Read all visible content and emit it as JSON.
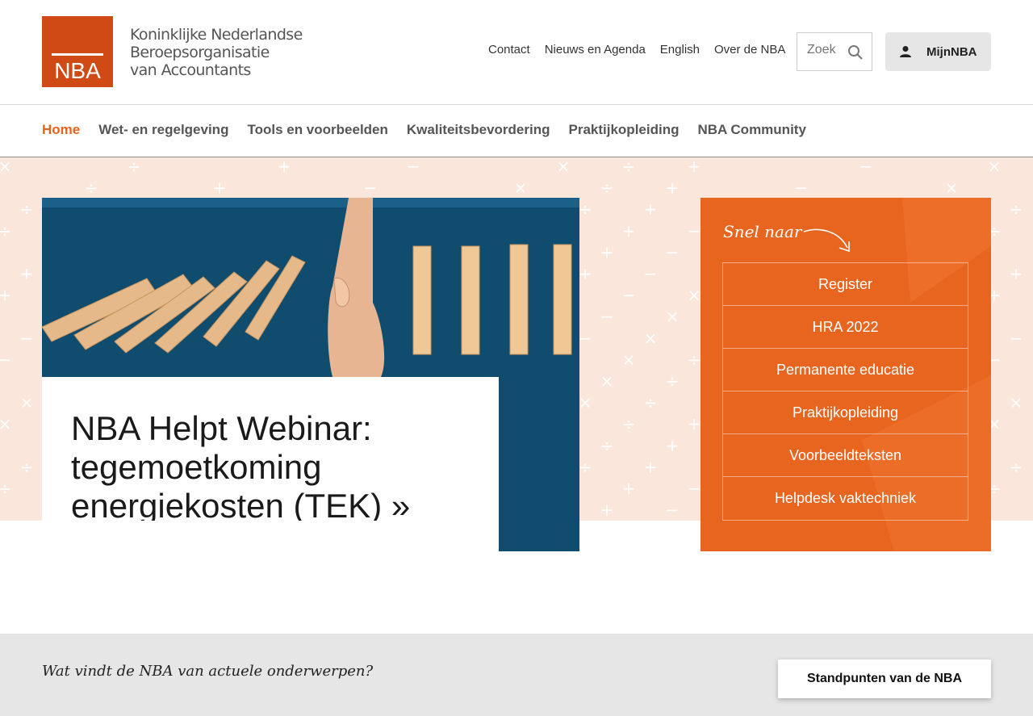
{
  "header": {
    "logo_text": "NBA",
    "org_name_lines": [
      "Koninklijke Nederlandse",
      "Beroepsorganisatie",
      "van Accountants"
    ],
    "util_nav": [
      "Contact",
      "Nieuws en Agenda",
      "English",
      "Over de NBA"
    ],
    "search_placeholder": "Zoek",
    "mijn_label": "MijnNBA"
  },
  "main_nav": {
    "items": [
      "Home",
      "Wet- en regelgeving",
      "Tools en voorbeelden",
      "Kwaliteitsbevordering",
      "Praktijkopleiding",
      "NBA Community"
    ],
    "active": "Home"
  },
  "hero": {
    "title": "NBA Helpt Webinar: tegemoetkoming energiekosten (TEK) »"
  },
  "snel_naar": {
    "title": "Snel naar",
    "items": [
      "Register",
      "HRA 2022",
      "Permanente educatie",
      "Praktijkopleiding",
      "Voorbeeldteksten",
      "Helpdesk vaktechniek"
    ]
  },
  "bottom": {
    "question": "Wat vindt de NBA van actuele onderwerpen?",
    "button_label": "Standpunten van de NBA"
  },
  "colors": {
    "brand_orange": "#e8651f",
    "logo_orange": "#cf4a14",
    "hero_bg": "#fbe6dc",
    "hero_blue": "#0f4c6e"
  }
}
